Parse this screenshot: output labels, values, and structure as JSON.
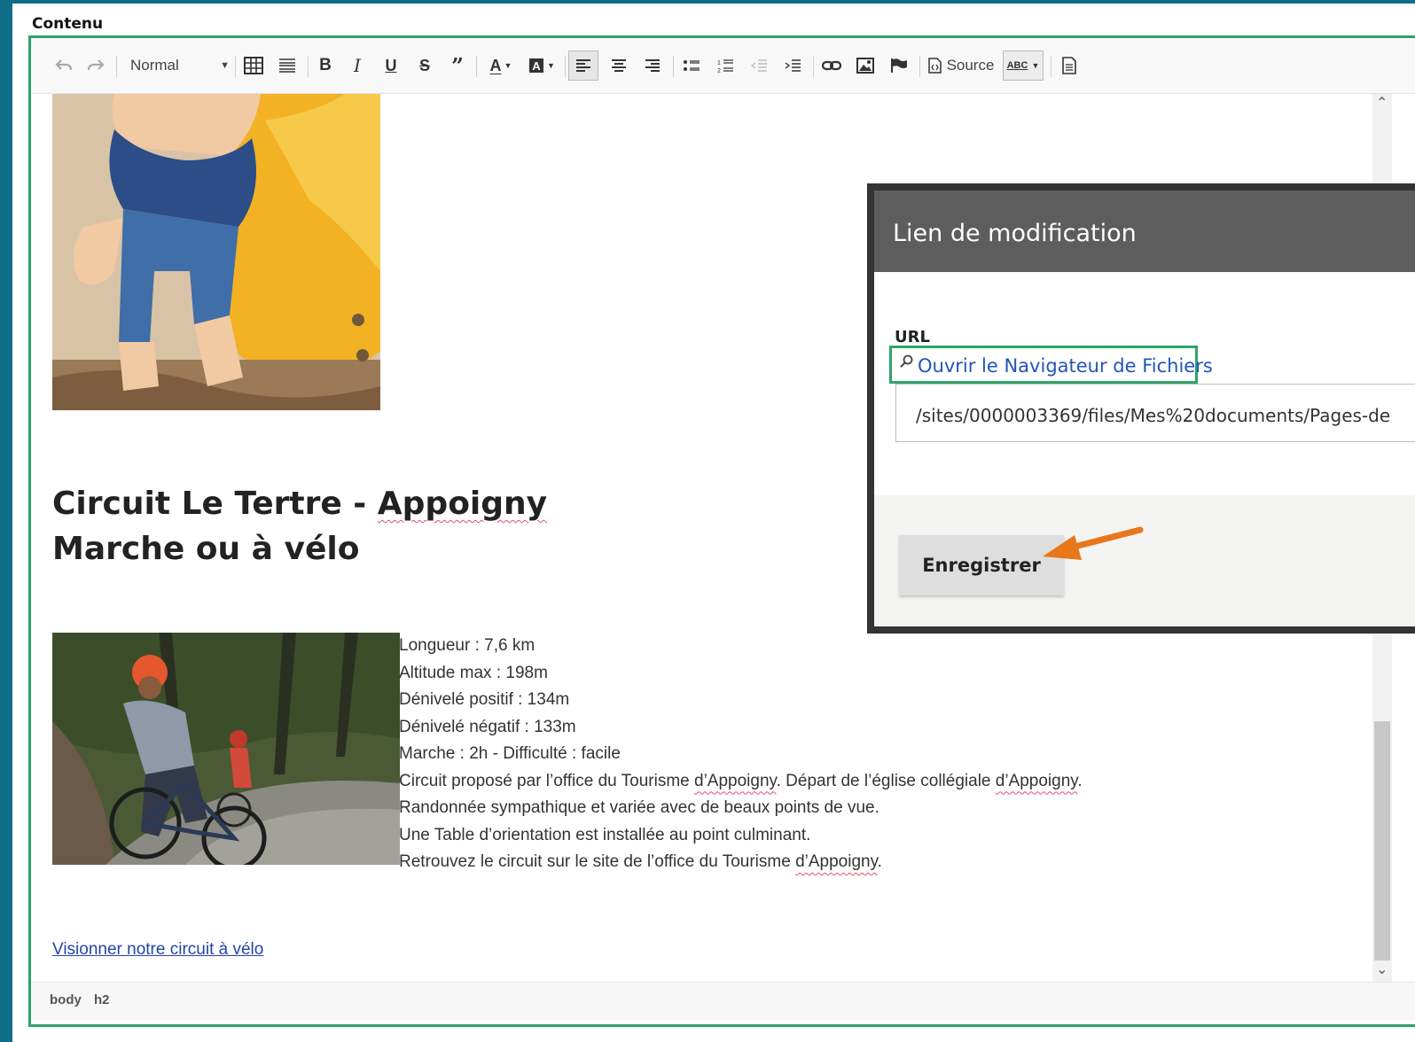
{
  "section_label": "Contenu",
  "toolbar": {
    "format_value": "Normal",
    "source_label": "Source",
    "spell_label": "ABC"
  },
  "content": {
    "heading_line1_a": "Circuit Le Tertre - ",
    "heading_line1_b": "Appoigny",
    "heading_line2": "Marche ou à vélo",
    "info": {
      "longueur": "Longueur : 7,6 km",
      "altitude": "Altitude max : 198m",
      "denivele_pos": "Dénivelé positif : 134m",
      "denivele_neg": "Dénivelé négatif : 133m",
      "marche": "Marche : 2h - Difficulté : facile",
      "circuit_a": "Circuit proposé par l’office du Tourisme ",
      "circuit_b": "d’Appoigny",
      "circuit_c": ". Départ de l’église collégiale ",
      "circuit_d": "d’Appoigny",
      "circuit_e": ".",
      "randonnee": "Randonnée sympathique et variée avec de beaux points de vue.",
      "table": "Une Table d’orientation est installée au point culminant.",
      "retrouvez_a": "Retrouvez le circuit sur le site de l’office du Tourisme ",
      "retrouvez_b": "d’Appoigny",
      "retrouvez_c": "."
    },
    "link_text": "Visionner notre circuit à vélo"
  },
  "statusbar": {
    "path": [
      "body",
      "h2"
    ]
  },
  "dialog": {
    "title": "Lien de modification",
    "url_label": "URL",
    "browse_label": "Ouvrir le Navigateur de Fichiers",
    "url_value": "/sites/0000003369/files/Mes%20documents/Pages-de",
    "save_label": "Enregistrer"
  },
  "colors": {
    "accent_green": "#2ea36b",
    "arrow_orange": "#e8761a",
    "link_blue": "#2244aa"
  }
}
